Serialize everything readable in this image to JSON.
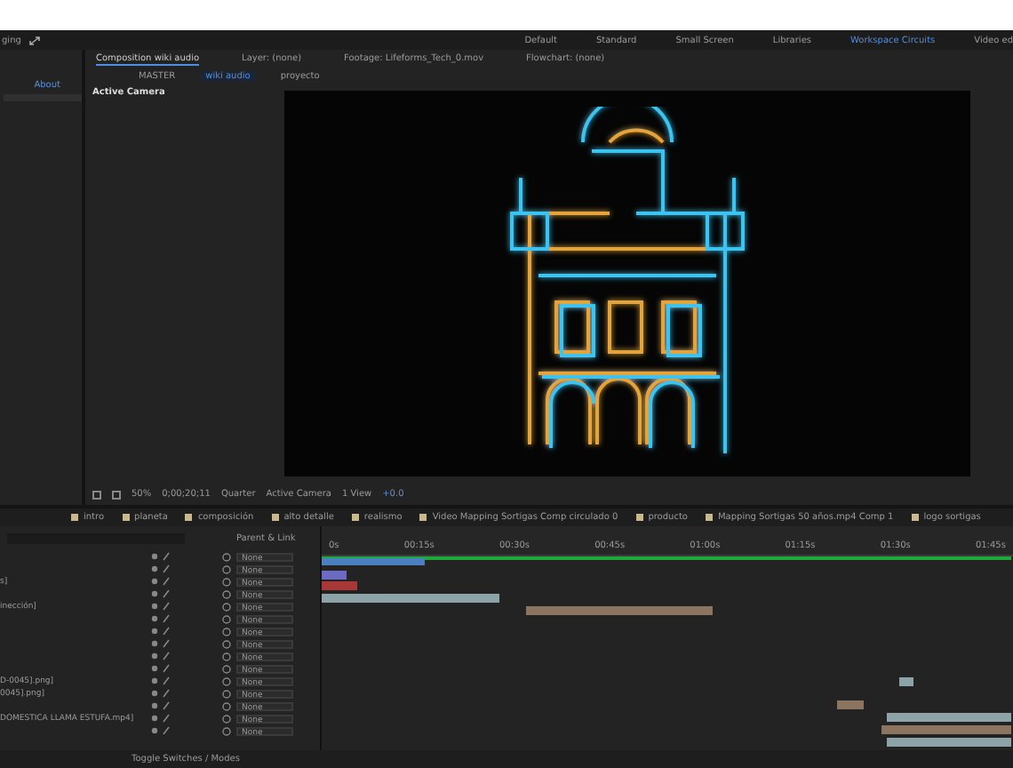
{
  "menubar": {
    "title": "ging",
    "workspaces": [
      {
        "label": "Default",
        "selected": false
      },
      {
        "label": "Standard",
        "selected": false
      },
      {
        "label": "Small Screen",
        "selected": false
      },
      {
        "label": "Libraries",
        "selected": false
      },
      {
        "label": "Workspace Circuits",
        "selected": true
      },
      {
        "label": "Video ed",
        "selected": false
      }
    ]
  },
  "viewer_tabs": [
    {
      "label": "Composition wiki audio",
      "selected": true
    },
    {
      "label": "Layer: (none)",
      "selected": false
    },
    {
      "label": "Footage: Lifeforms_Tech_0.mov",
      "selected": false
    },
    {
      "label": "Flowchart: (none)",
      "selected": false
    }
  ],
  "breadcrumbs": [
    {
      "label": "MASTER",
      "selected": false
    },
    {
      "label": "wiki audio",
      "selected": true
    },
    {
      "label": "proyecto",
      "selected": false
    }
  ],
  "left_panel": {
    "link": "About"
  },
  "viewer": {
    "camera_label": "Active Camera",
    "toolbar": {
      "zoom": "50%",
      "timecode": "0;00;20;11",
      "resolution": "Quarter",
      "camera": "Active Camera",
      "views": "1 View",
      "exposure": "+0.0"
    }
  },
  "timeline": {
    "tabs": [
      {
        "label": "intro",
        "selected": false
      },
      {
        "label": "planeta",
        "selected": false
      },
      {
        "label": "composición",
        "selected": false
      },
      {
        "label": "alto detalle",
        "selected": false
      },
      {
        "label": "realismo",
        "selected": false
      },
      {
        "label": "Video Mapping Sortigas Comp circulado 0",
        "selected": false
      },
      {
        "label": "producto",
        "selected": false
      },
      {
        "label": "Mapping Sortigas 50 años.mp4 Comp 1",
        "selected": false
      },
      {
        "label": "logo sortigas",
        "selected": false
      }
    ],
    "ruler": [
      "0s",
      "00:15s",
      "00:30s",
      "00:45s",
      "01:00s",
      "01:15s",
      "01:30s",
      "01:45s"
    ],
    "parent_header": "Parent & Link",
    "layers": [
      {
        "parent": "None"
      },
      {
        "parent": "None"
      },
      {
        "name": "s]",
        "parent": "None"
      },
      {
        "parent": "None"
      },
      {
        "name": "inección]",
        "parent": "None"
      },
      {
        "parent": "None"
      },
      {
        "parent": "None"
      },
      {
        "parent": "None"
      },
      {
        "parent": "None"
      },
      {
        "parent": "None"
      },
      {
        "name": "D-0045].png]",
        "parent": "None"
      },
      {
        "name": "0045].png]",
        "parent": "None"
      },
      {
        "parent": "None"
      },
      {
        "name": "DOMESTICA LLAMA ESTUFA.mp4]",
        "parent": "None"
      },
      {
        "parent": "None"
      }
    ],
    "footer": "Toggle Switches / Modes"
  }
}
